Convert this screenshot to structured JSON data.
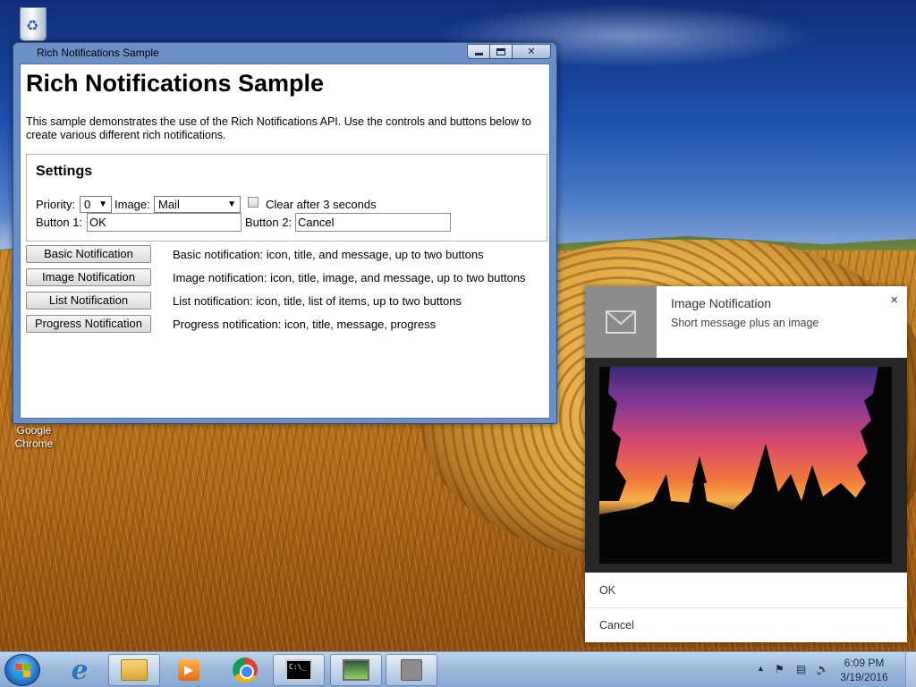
{
  "desktop": {
    "icons": {
      "chrome_label": "Google\nChrome"
    }
  },
  "window": {
    "title": "Rich Notifications Sample",
    "controls": {
      "minimize": "minimize",
      "maximize": "maximize",
      "close": "close"
    }
  },
  "page": {
    "heading": "Rich Notifications Sample",
    "intro": "This sample demonstrates the use of the Rich Notifications API. Use the controls and buttons below to create various different rich notifications."
  },
  "settings": {
    "heading": "Settings",
    "priority_label": "Priority:",
    "priority_value": "0",
    "image_label": "Image:",
    "image_value": "Mail",
    "clear_label": "Clear after 3 seconds",
    "clear_checked": false,
    "button1_label": "Button 1:",
    "button1_value": "OK",
    "button2_label": "Button 2:",
    "button2_value": "Cancel"
  },
  "actions": [
    {
      "button": "Basic Notification",
      "description": "Basic notification: icon, title, and message, up to two buttons"
    },
    {
      "button": "Image Notification",
      "description": "Image notification: icon, title, image, and message, up to two buttons"
    },
    {
      "button": "List Notification",
      "description": "List notification: icon, title, list of items, up to two buttons"
    },
    {
      "button": "Progress Notification",
      "description": "Progress notification: icon, title, message, progress"
    }
  ],
  "notification": {
    "title": "Image Notification",
    "message": "Short message plus an image",
    "close_glyph": "×",
    "icon": "mail-icon",
    "buttons": [
      "OK",
      "Cancel"
    ]
  },
  "taskbar": {
    "items": [
      "internet-explorer",
      "windows-explorer",
      "windows-media-center",
      "google-chrome",
      "command-prompt",
      "resource-monitor",
      "app-window"
    ],
    "tray": {
      "show_hidden": "▲",
      "flag": "⚑",
      "network": "▤",
      "volume": "🔈"
    },
    "time": "6:09 PM",
    "date": "3/19/2016"
  },
  "colors": {
    "titlebar": "#6b8fc7",
    "notif_icon_bg": "#8b8b8b",
    "taskbar": "#9fbbdc"
  }
}
